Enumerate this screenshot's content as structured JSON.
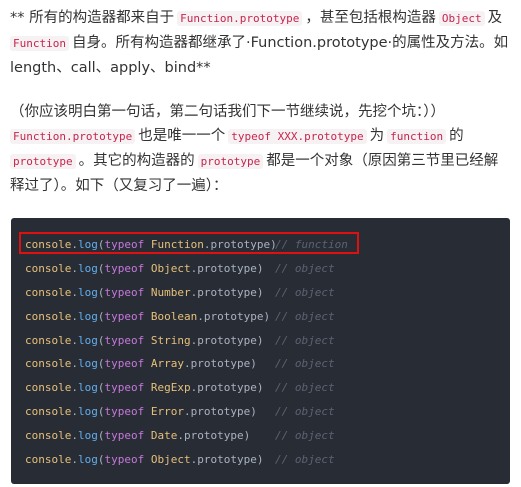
{
  "para1": {
    "s1": "** 所有的构造器都来自于",
    "c1": "Function.prototype",
    "s2": "，甚至包括根构造器",
    "c2": "Object",
    "s3": "及",
    "c3": "Function",
    "s4": "自身。所有构造器都继承了·Function.prototype·的属性及方法。如 length、call、apply、bind**"
  },
  "para2": {
    "s1": "（你应该明白第一句话，第二句话我们下一节继续说，先挖个坑：））",
    "c1": "Function.prototype",
    "s2": "也是唯一一个",
    "c2": "typeof XXX.prototype",
    "s3": "为",
    "c3": "function",
    "s4": "的",
    "c4": "prototype",
    "s5": "。其它的构造器的",
    "c5": "prototype",
    "s6": "都是一个对象（原因第三节里已经解释过了）。如下（又复习了一遍）："
  },
  "code": {
    "console": "console",
    "dot": ".",
    "log": "log",
    "open": "(",
    "typeof": "typeof",
    "rest": ".prototype)",
    "lines": [
      {
        "cls": "Function",
        "comment": "// function"
      },
      {
        "cls": "Object",
        "comment": "// object"
      },
      {
        "cls": "Number",
        "comment": "// object"
      },
      {
        "cls": "Boolean",
        "comment": "// object"
      },
      {
        "cls": "String",
        "comment": "// object"
      },
      {
        "cls": "Array",
        "comment": "// object"
      },
      {
        "cls": "RegExp",
        "comment": "// object"
      },
      {
        "cls": "Error",
        "comment": "// object"
      },
      {
        "cls": "Date",
        "comment": "// object"
      },
      {
        "cls": "Object",
        "comment": "// object"
      }
    ]
  },
  "colors": {
    "code_bg": "#282c34",
    "inline_code": "#c7254e",
    "highlight_box": "#e01010"
  }
}
